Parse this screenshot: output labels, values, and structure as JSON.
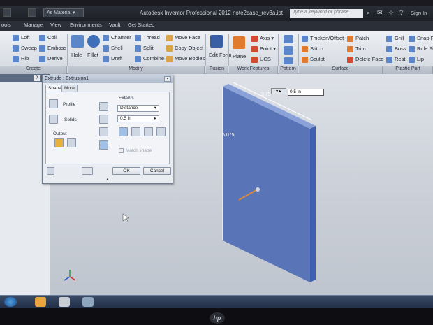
{
  "titlebar": {
    "material": "As Material",
    "app_title": "Autodesk Inventor Professional 2012   note2case_rev3a.ipt",
    "search_placeholder": "Type a keyword or phrase",
    "signin": "Sign In"
  },
  "tabs": [
    "ools",
    "Manage",
    "View",
    "Environments",
    "Vault",
    "Get Started"
  ],
  "ribbon": {
    "create": {
      "label": "Create",
      "items": [
        "Loft",
        "Coil",
        "Sweep",
        "Emboss",
        "Rib",
        "Derive"
      ]
    },
    "modify": {
      "label": "Modify",
      "hole": "Hole",
      "fillet": "Fillet",
      "items": [
        "Chamfer",
        "Thread",
        "Shell",
        "Split",
        "Draft",
        "Combine"
      ],
      "move_items": [
        "Move Face",
        "Copy Object",
        "Move Bodies"
      ]
    },
    "fusion": {
      "label": "Fusion",
      "edit_form": "Edit Form"
    },
    "work_features": {
      "label": "Work Features",
      "plane": "Plane",
      "items": [
        "Axis",
        "Point",
        "UCS"
      ]
    },
    "pattern": {
      "label": "Pattern"
    },
    "surface": {
      "label": "Surface",
      "items": [
        "Thicken/Offset",
        "Patch",
        "Stitch",
        "Trim",
        "Sculpt",
        "Delete Face"
      ]
    },
    "plastic_part": {
      "label": "Plastic Part",
      "items": [
        "Grill",
        "Snap Fit",
        "Boss",
        "Rule Fill",
        "Rest",
        "Lip"
      ]
    }
  },
  "dialog": {
    "title": "Extrude : Extrusion1",
    "tabs": [
      "Shape",
      "More"
    ],
    "profile": "Profile",
    "solids": "Solids",
    "output": "Output",
    "extents": "Extents",
    "extents_value": "Distance",
    "distance": "0.5 in",
    "match_shape": "Match shape",
    "ok": "OK",
    "cancel": "Cancel"
  },
  "viewport": {
    "width_dim": "3.75",
    "height_dim": "6.075",
    "inline_input": "0.5 in"
  },
  "hp_logo": "hp",
  "colors": {
    "part_face": "#5a74b8",
    "part_side": "#3f5fb0",
    "dim_line": "#ffffff"
  }
}
